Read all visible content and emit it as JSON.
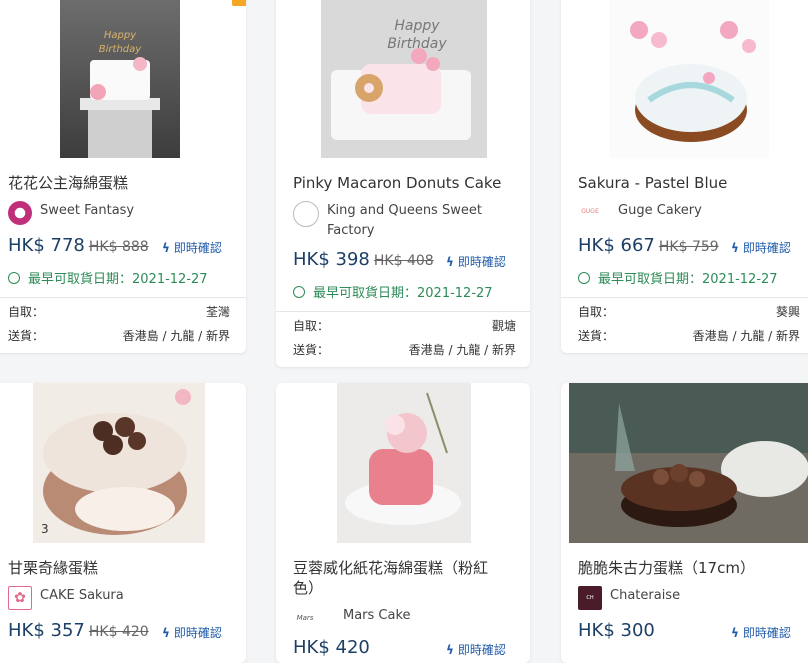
{
  "labels": {
    "pickup": "自取：",
    "delivery": "送貨：",
    "instant": "即時確認",
    "earliest_prefix": "最早可取貨日期："
  },
  "colors": {
    "price": "#1e3f66",
    "instant": "#1e5aa8",
    "available": "#2e8b57"
  },
  "products": [
    {
      "title": "花花公主海綿蛋糕",
      "shop": "Sweet Fantasy",
      "price": "HK$ 778",
      "old_price": "HK$ 888",
      "earliest": "2021-12-27",
      "pickup": "荃灣",
      "delivery": "香港島 / 九龍 / 新界"
    },
    {
      "title": "Pinky Macaron Donuts Cake",
      "shop": "King and Queens Sweet Factory",
      "price": "HK$ 398",
      "old_price": "HK$ 408",
      "earliest": "2021-12-27",
      "pickup": "觀塘",
      "delivery": "香港島 / 九龍 / 新界"
    },
    {
      "title": "Sakura - Pastel Blue",
      "shop": "Guge Cakery",
      "price": "HK$ 667",
      "old_price": "HK$ 759",
      "earliest": "2021-12-27",
      "pickup": "葵興",
      "delivery": "香港島 / 九龍 / 新界"
    },
    {
      "title": "甘栗奇緣蛋糕",
      "shop": "CAKE Sakura",
      "price": "HK$ 357",
      "old_price": "HK$ 420"
    },
    {
      "title": "豆蓉威化紙花海綿蛋糕（粉紅色）",
      "shop": "Mars Cake",
      "price": "HK$ 420"
    },
    {
      "title": "脆脆朱古力蛋糕（17cm）",
      "shop": "Chateraise",
      "price": "HK$ 300"
    }
  ]
}
